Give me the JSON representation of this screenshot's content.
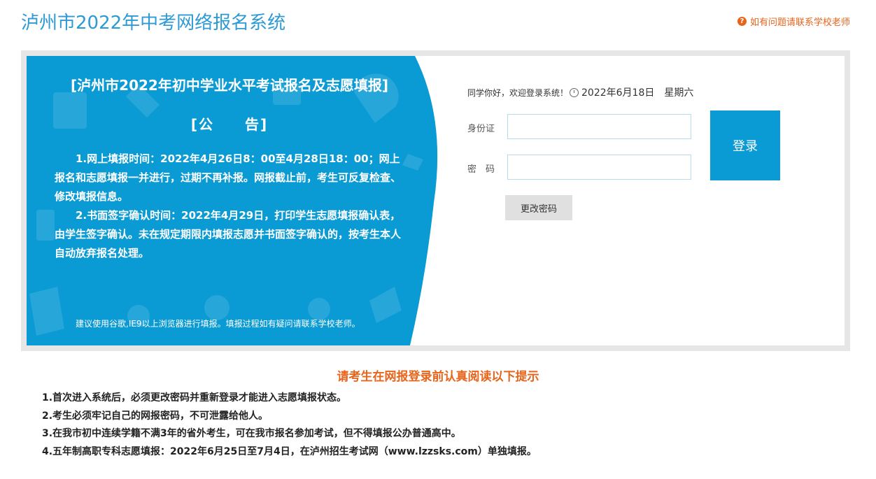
{
  "header": {
    "title": "泸州市2022年中考网络报名系统",
    "help_link": "如有问题请联系学校老师"
  },
  "notice": {
    "title": "[泸州市2022年初中学业水平考试报名及志愿填报]",
    "subtitle": "[公　　告]",
    "paragraphs": [
      "1.网上填报时间：2022年4月26日8：00至4月28日18：00；网上报名和志愿填报一并进行，过期不再补报。网报截止前，考生可反复检查、修改填报信息。",
      "2.书面签字确认时间：2022年4月29日，打印学生志愿填报确认表，由学生签字确认。未在规定期限内填报志愿并书面签字确认的，按考生本人自动放弃报名处理。"
    ],
    "footer": "建议使用谷歌,IE9以上浏览器进行填报。填报过程如有疑问请联系学校老师。"
  },
  "login": {
    "greeting": "同学你好，欢迎登录系统！",
    "date": "2022年6月18日",
    "weekday": "星期六",
    "id_label": "身份证",
    "password_label": "密　码",
    "id_value": "",
    "password_value": "",
    "login_button": "登录",
    "change_password_button": "更改密码"
  },
  "tips": {
    "title": "请考生在网报登录前认真阅读以下提示",
    "items": [
      "1.首次进入系统后，必须更改密码并重新登录才能进入志愿填报状态。",
      "2.考生必须牢记自己的网报密码，不可泄露给他人。",
      "3.在我市初中连续学籍不满3年的省外考生，可在我市报名参加考试，但不得填报公办普通高中。",
      "4.五年制高职专科志愿填报：2022年6月25日至7月4日，在泸州招生考试网（www.lzzsks.com）单独填报。"
    ]
  },
  "colors": {
    "brand_blue": "#2d9ad6",
    "panel_blue": "#0a9ad4",
    "accent_orange": "#e8641b"
  }
}
